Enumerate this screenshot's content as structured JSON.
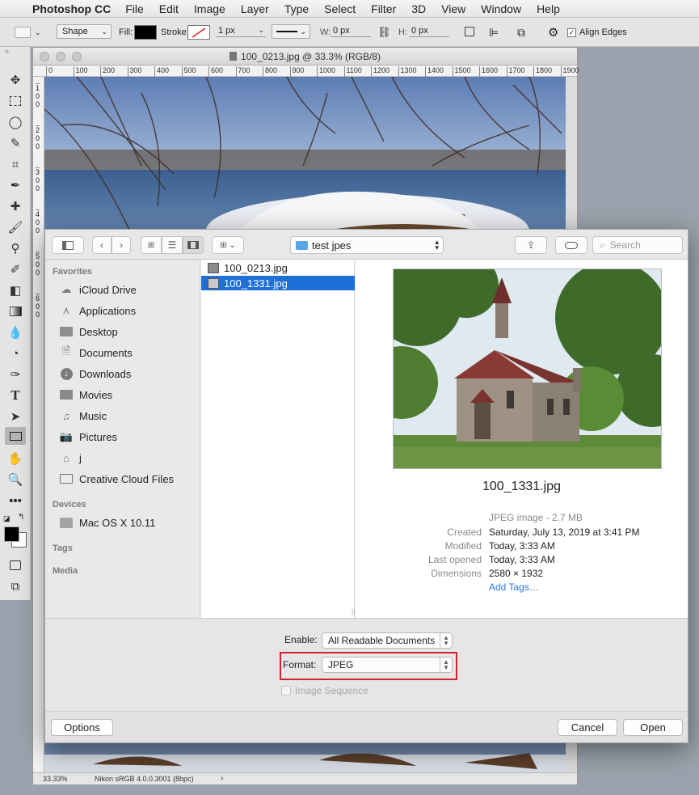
{
  "menubar": {
    "app_name": "Photoshop CC",
    "items": [
      "File",
      "Edit",
      "Image",
      "Layer",
      "Type",
      "Select",
      "Filter",
      "3D",
      "View",
      "Window",
      "Help"
    ]
  },
  "options_bar": {
    "shape_mode": "Shape",
    "fill_label": "Fill:",
    "stroke_label": "Stroke:",
    "stroke_width": "1 px",
    "w_label": "W:",
    "w_value": "0 px",
    "h_label": "H:",
    "h_value": "0 px",
    "align_edges": "Align Edges"
  },
  "document": {
    "title": "100_0213.jpg @ 33.3% (RGB/8)",
    "ruler_h_ticks": [
      "0",
      "100",
      "200",
      "300",
      "400",
      "500",
      "600",
      "700",
      "800",
      "900",
      "1000",
      "1100",
      "1200",
      "1300",
      "1400",
      "1500",
      "1600",
      "1700",
      "1800",
      "1900"
    ],
    "ruler_v_ticks": [
      "1\n0\n0",
      "2\n0\n0",
      "3\n0\n0",
      "4\n0\n0",
      "5\n0\n0",
      "6\n0\n0"
    ],
    "zoom": "33.33%",
    "color_profile": "Nikon sRGB 4.0.0.3001 (8bpc)"
  },
  "dialog": {
    "location": "test jpes",
    "search_placeholder": "Search",
    "sidebar": {
      "favorites_head": "Favorites",
      "favorites": [
        {
          "label": "iCloud Drive",
          "icon": "cloud-icon"
        },
        {
          "label": "Applications",
          "icon": "applications-icon"
        },
        {
          "label": "Desktop",
          "icon": "desktop-icon"
        },
        {
          "label": "Documents",
          "icon": "documents-icon"
        },
        {
          "label": "Downloads",
          "icon": "downloads-icon"
        },
        {
          "label": "Movies",
          "icon": "movies-icon"
        },
        {
          "label": "Music",
          "icon": "music-icon"
        },
        {
          "label": "Pictures",
          "icon": "pictures-icon"
        },
        {
          "label": "j",
          "icon": "home-icon"
        },
        {
          "label": "Creative Cloud Files",
          "icon": "folder-icon"
        }
      ],
      "devices_head": "Devices",
      "devices": [
        {
          "label": "Mac OS X 10.11",
          "icon": "disk-icon"
        }
      ],
      "tags_head": "Tags",
      "media_head": "Media"
    },
    "files": [
      {
        "name": "100_0213.jpg",
        "selected": false
      },
      {
        "name": "100_1331.jpg",
        "selected": true
      }
    ],
    "preview": {
      "filename": "100_1331.jpg",
      "kind": "JPEG image - 2.7 MB",
      "created_label": "Created",
      "created": "Saturday, July 13, 2019 at 3:41 PM",
      "modified_label": "Modified",
      "modified": "Today, 3:33 AM",
      "last_opened_label": "Last opened",
      "last_opened": "Today, 3:33 AM",
      "dimensions_label": "Dimensions",
      "dimensions": "2580 × 1932",
      "add_tags": "Add Tags…"
    },
    "enable_label": "Enable:",
    "enable_value": "All Readable Documents",
    "format_label": "Format:",
    "format_value": "JPEG",
    "image_sequence": "Image Sequence",
    "options_button": "Options",
    "cancel_button": "Cancel",
    "open_button": "Open",
    "highlight_color": "#d0232a",
    "selection_color": "#1e6fd6"
  }
}
